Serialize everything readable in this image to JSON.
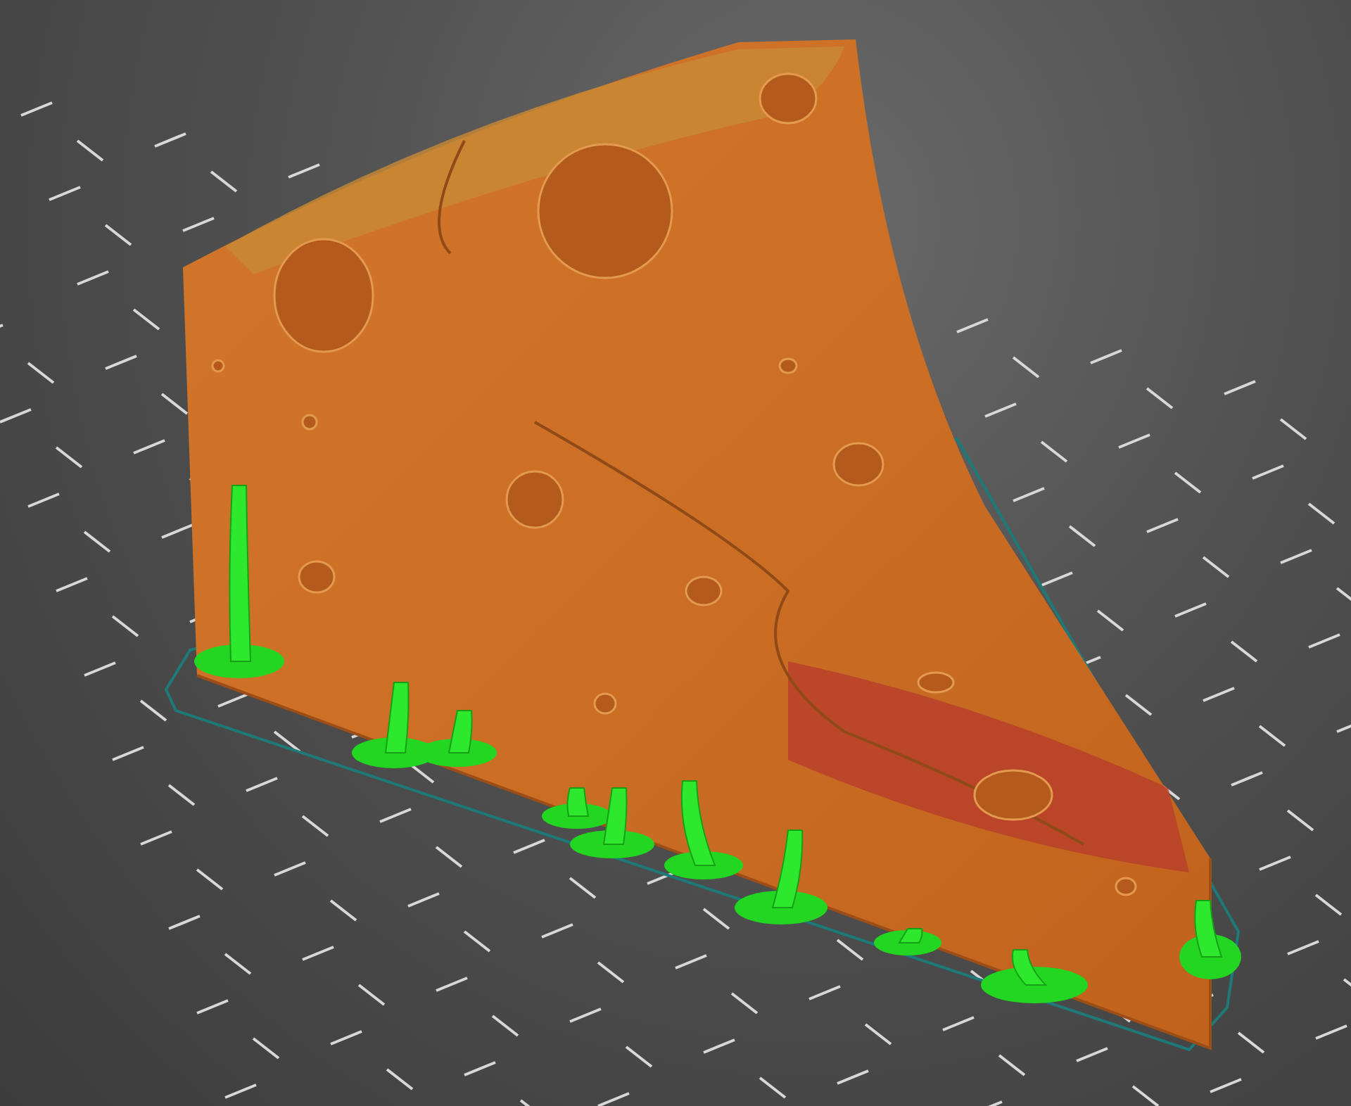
{
  "viewport": {
    "kind": "sliced-model-preview"
  }
}
